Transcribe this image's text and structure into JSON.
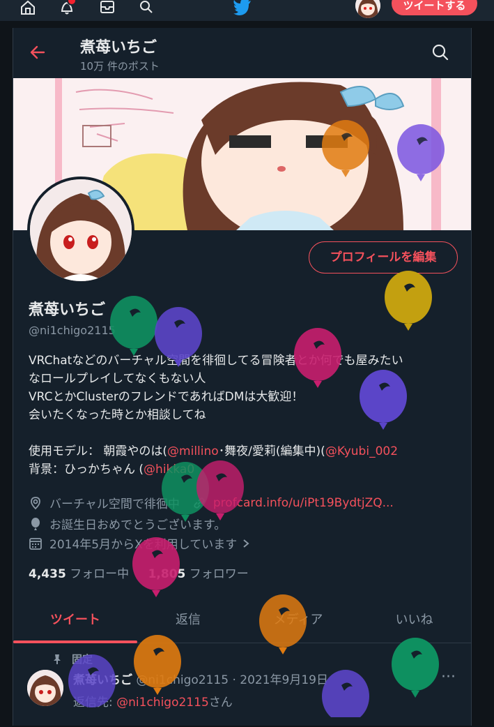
{
  "topbar": {
    "tweet_button": "ツイートする",
    "icons": [
      "home-icon",
      "notifications-icon",
      "messages-icon",
      "search-icon",
      "twitter-logo"
    ]
  },
  "header": {
    "title": "煮苺いちご",
    "post_count": "10万 件のポスト"
  },
  "profile": {
    "edit_button": "プロフィールを編集",
    "name": "煮苺いちご",
    "handle": "@ni1chigo2115",
    "bio_line1": "VRChatなどのバーチャル空間を徘徊してる冒険者とか何でも屋みたい",
    "bio_line2": "なロールプレイしてなくもない人",
    "bio_line3": "VRCとかClusterのフレンドであればDMは大歓迎！",
    "bio_line4": "会いたくなった時とか相談してね",
    "bio_model_prefix": "使用モデル： 朝霞やのは(",
    "bio_model_mention1": "@millino",
    "bio_model_mid": "･舞夜/愛莉(編集中)(",
    "bio_model_mention2": "@Kyubi_002",
    "bio_bg_prefix": "背景：ひっかちゃん (",
    "bio_bg_mention": "@hikka0",
    "location": "バーチャル空間で徘徊中",
    "website": "profcard.info/u/iPt19BydtjZQ...",
    "birthday": "お誕生日おめでとうございます。",
    "joined": "2014年5月からXを利用しています",
    "following_count": "4,435",
    "following_label": "フォロー中",
    "followers_count": "1,805",
    "followers_label": "フォロワー"
  },
  "tabs": [
    {
      "label": "ツイート",
      "active": true
    },
    {
      "label": "返信",
      "active": false
    },
    {
      "label": "メディア",
      "active": false
    },
    {
      "label": "いいね",
      "active": false
    }
  ],
  "tweet": {
    "pinned_label": "固定",
    "author_name": "煮苺いちご",
    "author_handle": "@ni1chigo2115",
    "separator": "·",
    "date": "2021年9月19日",
    "reply_prefix": "返信先: ",
    "reply_mention": "@ni1chigo2115",
    "reply_suffix": "さん",
    "more": "···"
  },
  "colors": {
    "accent": "#f4515c",
    "background": "#15202b",
    "secondary_text": "#8b98a5",
    "balloons": [
      "#e07b10",
      "#7a55e0",
      "#c3a010",
      "#0e9060",
      "#5b45c8",
      "#c81e6e"
    ]
  }
}
